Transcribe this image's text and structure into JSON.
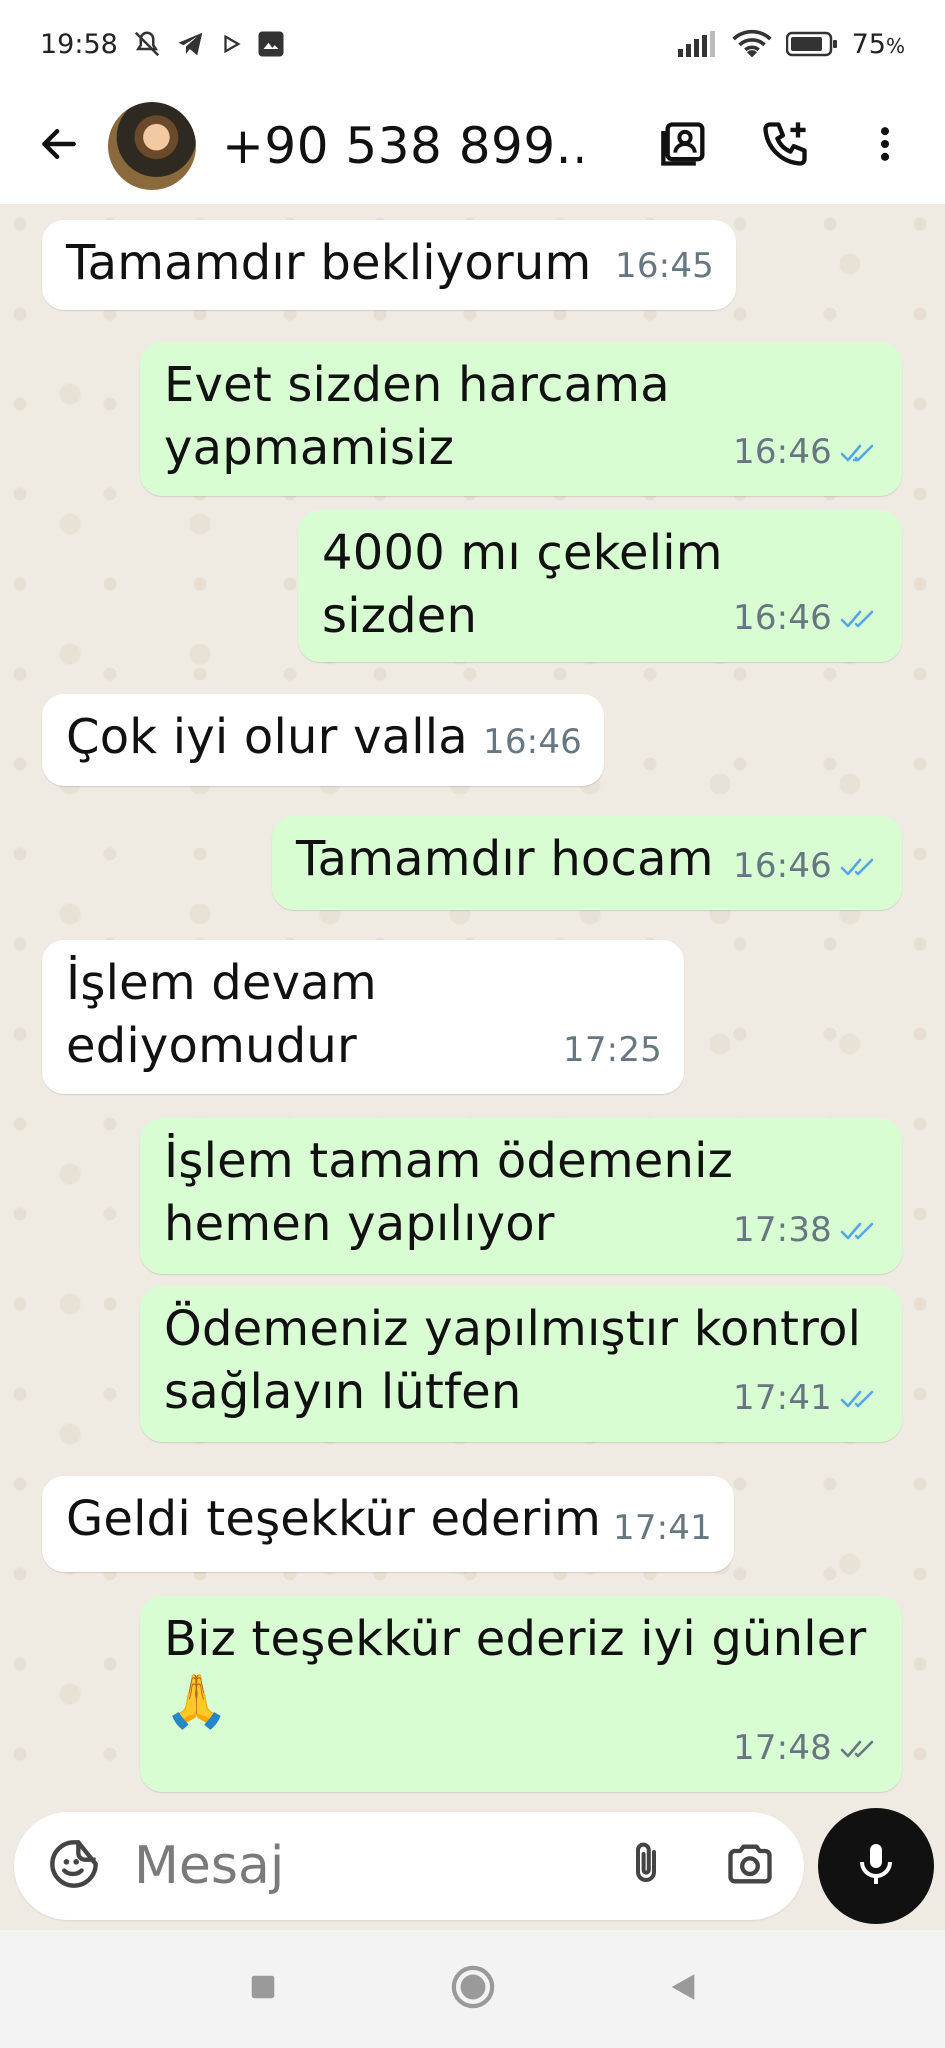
{
  "status_bar": {
    "time": "19:58",
    "battery": "75",
    "battery_suffix": "%",
    "icons": [
      "bell-off-icon",
      "telegram-icon",
      "play-icon",
      "photo-icon",
      "signal-icon",
      "wifi-icon",
      "battery-icon"
    ]
  },
  "header": {
    "contact_name": "+90 538 899...",
    "icons": [
      "back-arrow-icon",
      "avatar",
      "contact-card-icon",
      "call-add-icon",
      "more-vert-icon"
    ]
  },
  "messages": [
    {
      "dir": "in",
      "text": "Tamamdır bekliyorum",
      "time": "16:45"
    },
    {
      "dir": "out",
      "text": "Evet sizden harcama\nyapmamisiz",
      "time": "16:46",
      "ticks": "read"
    },
    {
      "dir": "out",
      "text": "4000 mı çekelim sizden",
      "time": "16:46",
      "ticks": "read"
    },
    {
      "dir": "in",
      "text": "Çok iyi olur valla",
      "time": "16:46"
    },
    {
      "dir": "out",
      "text": "Tamamdır hocam",
      "time": "16:46",
      "ticks": "read"
    },
    {
      "dir": "in",
      "text": "İşlem devam ediyomudur",
      "time": "17:25"
    },
    {
      "dir": "out",
      "text": "İşlem tamam ödemeniz\nhemen yapılıyor",
      "time": "17:38",
      "ticks": "read"
    },
    {
      "dir": "out",
      "text": "Ödemeniz yapılmıştır kontrol\nsağlayın lütfen",
      "time": "17:41",
      "ticks": "read"
    },
    {
      "dir": "in",
      "text": "Geldi teşekkür ederim",
      "time": "17:41"
    },
    {
      "dir": "out",
      "text": "Biz teşekkür ederiz iyi günler",
      "emoji": "🙏",
      "time": "17:48",
      "ticks": "delivered"
    }
  ],
  "input": {
    "placeholder": "Mesaj"
  },
  "colors": {
    "incoming_bubble": "#ffffff",
    "outgoing_bubble": "#d9fdd3",
    "read_tick": "#53a6e6",
    "delivered_tick": "#667781",
    "chat_background": "#efeae2"
  }
}
